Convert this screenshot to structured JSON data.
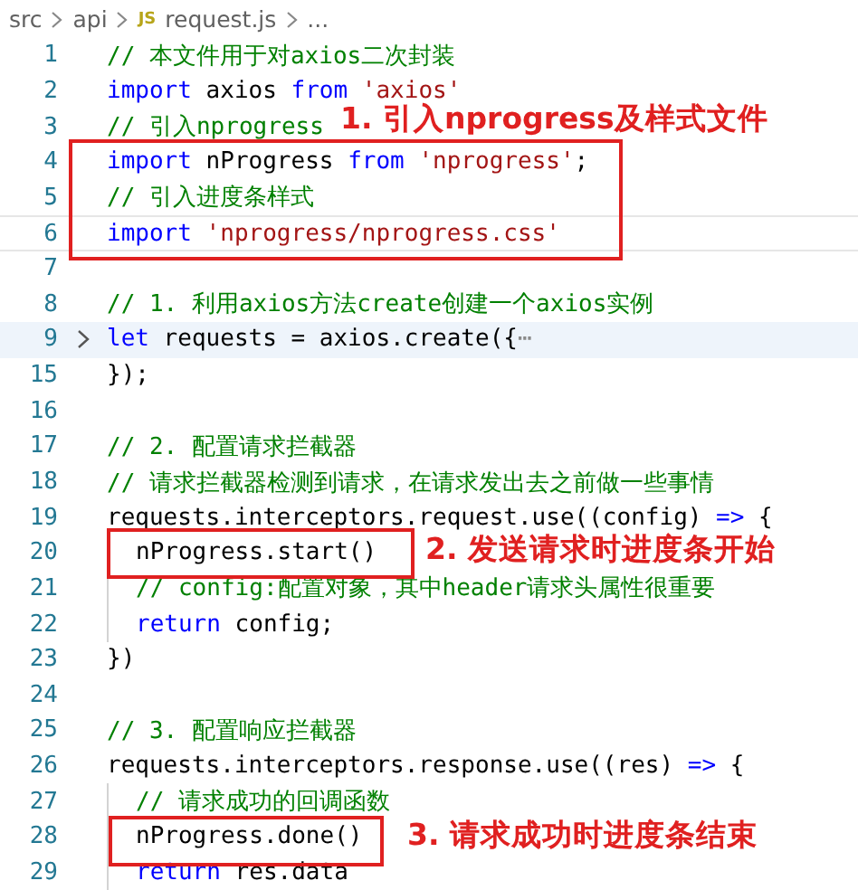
{
  "breadcrumb": {
    "items": [
      {
        "kind": "folder",
        "text": "src"
      },
      {
        "kind": "folder",
        "text": "api"
      },
      {
        "kind": "file",
        "icon": "JS",
        "text": "request.js"
      },
      {
        "kind": "more",
        "text": "..."
      }
    ]
  },
  "lines": [
    {
      "number": "1",
      "tokens": [
        {
          "kind": "comment",
          "text": "// 本文件用于对axios二次封装"
        }
      ]
    },
    {
      "number": "2",
      "tokens": [
        {
          "kind": "keyword",
          "text": "import"
        },
        {
          "kind": "plain",
          "text": " axios "
        },
        {
          "kind": "keyword",
          "text": "from"
        },
        {
          "kind": "string",
          "text": " 'axios'"
        }
      ]
    },
    {
      "number": "3",
      "tokens": [
        {
          "kind": "comment",
          "text": "// 引入nprogress"
        }
      ]
    },
    {
      "number": "4",
      "tokens": [
        {
          "kind": "keyword",
          "text": "import"
        },
        {
          "kind": "plain",
          "text": " nProgress "
        },
        {
          "kind": "keyword",
          "text": "from"
        },
        {
          "kind": "string",
          "text": " 'nprogress'"
        },
        {
          "kind": "plain",
          "text": ";"
        }
      ]
    },
    {
      "number": "5",
      "tokens": [
        {
          "kind": "comment",
          "text": "// 引入进度条样式"
        }
      ]
    },
    {
      "number": "6",
      "outlined": true,
      "tokens": [
        {
          "kind": "keyword",
          "text": "import"
        },
        {
          "kind": "string",
          "text": " 'nprogress/nprogress.css'"
        }
      ]
    },
    {
      "number": "7"
    },
    {
      "number": "8",
      "tokens": [
        {
          "kind": "comment",
          "text": "// 1. 利用axios方法create创建一个axios实例"
        }
      ]
    },
    {
      "number": "9",
      "current": true,
      "folded": true,
      "tokens": [
        {
          "kind": "keyword",
          "text": "let"
        },
        {
          "kind": "plain",
          "text": " requests = axios.create({"
        },
        {
          "kind": "fold",
          "text": "⋯"
        }
      ]
    },
    {
      "number": "15",
      "tokens": [
        {
          "kind": "plain",
          "text": "});"
        }
      ]
    },
    {
      "number": "16"
    },
    {
      "number": "17",
      "tokens": [
        {
          "kind": "comment",
          "text": "// 2. 配置请求拦截器"
        }
      ]
    },
    {
      "number": "18",
      "tokens": [
        {
          "kind": "comment",
          "text": "// 请求拦截器检测到请求，在请求发出去之前做一些事情"
        }
      ]
    },
    {
      "number": "19",
      "tokens": [
        {
          "kind": "plain",
          "text": "requests.interceptors.request.use((config) "
        },
        {
          "kind": "keyword",
          "text": "=>"
        },
        {
          "kind": "plain",
          "text": " {"
        }
      ]
    },
    {
      "number": "20",
      "indented": true,
      "tokens": [
        {
          "kind": "plain",
          "text": "nProgress.start()"
        }
      ]
    },
    {
      "number": "21",
      "indented": true,
      "tokens": [
        {
          "kind": "comment",
          "text": "// config:配置对象，其中header请求头属性很重要"
        }
      ]
    },
    {
      "number": "22",
      "indented": true,
      "tokens": [
        {
          "kind": "keyword",
          "text": "return"
        },
        {
          "kind": "plain",
          "text": " config;"
        }
      ]
    },
    {
      "number": "23",
      "tokens": [
        {
          "kind": "plain",
          "text": "})"
        }
      ]
    },
    {
      "number": "24"
    },
    {
      "number": "25",
      "tokens": [
        {
          "kind": "comment",
          "text": "// 3. 配置响应拦截器"
        }
      ]
    },
    {
      "number": "26",
      "tokens": [
        {
          "kind": "plain",
          "text": "requests.interceptors.response.use((res) "
        },
        {
          "kind": "keyword",
          "text": "=>"
        },
        {
          "kind": "plain",
          "text": " {"
        }
      ]
    },
    {
      "number": "27",
      "indented": true,
      "tokens": [
        {
          "kind": "comment",
          "text": "// 请求成功的回调函数"
        }
      ]
    },
    {
      "number": "28",
      "indented": true,
      "tokens": [
        {
          "kind": "plain",
          "text": "nProgress.done()"
        }
      ]
    },
    {
      "number": "29",
      "indented": true,
      "tokens": [
        {
          "kind": "keyword",
          "text": "return"
        },
        {
          "kind": "plain",
          "text": " res.data"
        }
      ]
    }
  ],
  "annotations": [
    {
      "text": "1. 引入nprogress及样式文件"
    },
    {
      "text": "2. 发送请求时进度条开始"
    },
    {
      "text": "3. 请求成功时进度条结束"
    }
  ]
}
